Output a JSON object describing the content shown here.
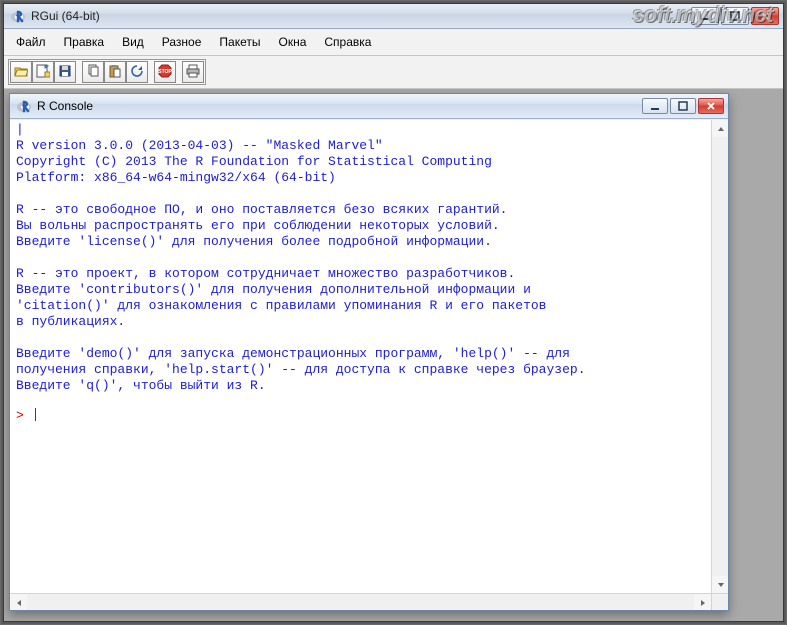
{
  "outer_window": {
    "title": "RGui (64-bit)"
  },
  "menu": {
    "items": [
      "Файл",
      "Правка",
      "Вид",
      "Разное",
      "Пакеты",
      "Окна",
      "Справка"
    ]
  },
  "toolbar": {
    "buttons": [
      {
        "name": "open-icon"
      },
      {
        "name": "load-workspace-icon"
      },
      {
        "name": "save-icon"
      },
      {
        "sep": true
      },
      {
        "name": "copy-icon"
      },
      {
        "name": "paste-icon"
      },
      {
        "name": "refresh-icon"
      },
      {
        "sep": true
      },
      {
        "name": "stop-icon"
      },
      {
        "sep": true
      },
      {
        "name": "print-icon"
      }
    ]
  },
  "inner_window": {
    "title": "R Console"
  },
  "console": {
    "text": "|\nR version 3.0.0 (2013-04-03) -- \"Masked Marvel\"\nCopyright (C) 2013 The R Foundation for Statistical Computing\nPlatform: x86_64-w64-mingw32/x64 (64-bit)\n\nR -- это свободное ПО, и оно поставляется безо всяких гарантий.\nВы вольны распространять его при соблюдении некоторых условий.\nВведите 'license()' для получения более подробной информации.\n\nR -- это проект, в котором сотрудничает множество разработчиков.\nВведите 'contributors()' для получения дополнительной информации и\n'citation()' для ознакомления с правилами упоминания R и его пакетов\nв публикациях.\n\nВведите 'demo()' для запуска демонстрационных программ, 'help()' -- для\nполучения справки, 'help.start()' -- для доступа к справке через браузер.\nВведите 'q()', чтобы выйти из R.",
    "prompt": "> "
  },
  "watermark": "soft.mydiv.net"
}
